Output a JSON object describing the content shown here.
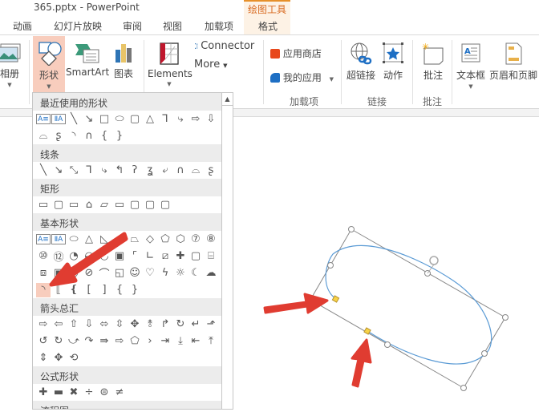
{
  "window": {
    "title": "365.pptx - PowerPoint"
  },
  "context_tab_group": {
    "title": "绘图工具",
    "accent": "#e6902a"
  },
  "tabs": [
    {
      "label": "动画"
    },
    {
      "label": "幻灯片放映"
    },
    {
      "label": "审阅"
    },
    {
      "label": "视图"
    },
    {
      "label": "加载项"
    },
    {
      "label": "格式"
    }
  ],
  "ribbon": {
    "album": {
      "label": "相册",
      "icon": "photo-album-icon"
    },
    "shapes": {
      "label": "形状",
      "icon": "shapes-icon",
      "active": true
    },
    "smartart": {
      "label": "SmartArt",
      "icon": "smartart-icon"
    },
    "chart": {
      "label": "图表",
      "icon": "chart-icon"
    },
    "elements": {
      "label": "Elements",
      "icon": "elements-icon"
    },
    "connector": {
      "label": "Connector",
      "icon": "connector-icon"
    },
    "more": {
      "label": "More"
    },
    "store": {
      "label": "应用商店",
      "icon": "store-icon"
    },
    "my_apps": {
      "label": "我的应用",
      "icon": "my-apps-icon"
    },
    "hyperlink": {
      "label": "超链接",
      "icon": "hyperlink-icon"
    },
    "action": {
      "label": "动作",
      "icon": "action-icon"
    },
    "comment": {
      "label": "批注",
      "icon": "comment-icon"
    },
    "textbox": {
      "label": "文本框",
      "icon": "textbox-icon"
    },
    "header_footer": {
      "label": "页眉和页脚",
      "icon": "header-footer-icon"
    },
    "groups": [
      {
        "label": "加载项"
      },
      {
        "label": "链接"
      },
      {
        "label": "批注"
      }
    ]
  },
  "gallery": {
    "categories": [
      {
        "title": "最近使用的形状"
      },
      {
        "title": "线条"
      },
      {
        "title": "矩形"
      },
      {
        "title": "基本形状"
      },
      {
        "title": "箭头总汇"
      },
      {
        "title": "公式形状"
      },
      {
        "title": "流程图"
      }
    ],
    "selected_shape": "arc"
  },
  "annotations": {
    "arrow_color": "#e03c31"
  },
  "selection": {
    "shape": "arc",
    "outline_color": "#5b9bd5",
    "adjust_handle_color": "#f7d347"
  }
}
